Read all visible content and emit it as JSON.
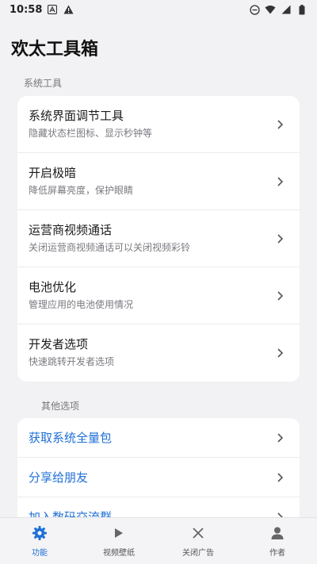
{
  "status_bar": {
    "time": "10:58",
    "icons_left": [
      "notification-a-icon",
      "warning-icon"
    ],
    "icons_right": [
      "dnd-icon",
      "wifi-icon",
      "signal-icon",
      "battery-icon"
    ]
  },
  "app": {
    "title": "欢太工具箱"
  },
  "sections": {
    "system": {
      "label": "系统工具",
      "items": [
        {
          "title": "系统界面调节工具",
          "subtitle": "隐藏状态栏图标、显示秒钟等"
        },
        {
          "title": "开启极暗",
          "subtitle": "降低屏幕亮度，保护眼睛"
        },
        {
          "title": "运营商视频通话",
          "subtitle": "关闭运营商视频通话可以关闭视频彩铃"
        },
        {
          "title": "电池优化",
          "subtitle": "管理应用的电池使用情况"
        },
        {
          "title": "开发者选项",
          "subtitle": "快速跳转开发者选项"
        }
      ]
    },
    "other": {
      "label": "其他选项",
      "items": [
        {
          "title": "获取系统全量包"
        },
        {
          "title": "分享给朋友"
        },
        {
          "title": "加入数码交流群"
        }
      ]
    }
  },
  "bottom_nav": {
    "active": 0,
    "tabs": [
      {
        "label": "功能",
        "icon": "gear-icon"
      },
      {
        "label": "视频壁纸",
        "icon": "play-icon"
      },
      {
        "label": "关闭广告",
        "icon": "close-icon"
      },
      {
        "label": "作者",
        "icon": "person-icon"
      }
    ]
  },
  "colors": {
    "accent": "#1f6fd6",
    "background": "#f2f2f4"
  }
}
